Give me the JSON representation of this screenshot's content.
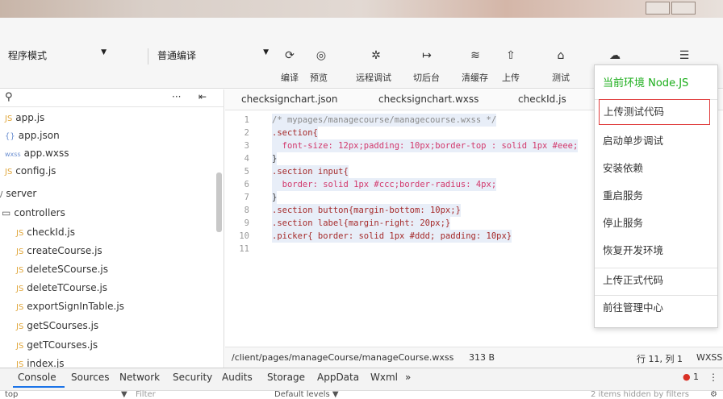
{
  "toolbar": {
    "mode_select": "程序模式",
    "compile_select": "普通编译",
    "buttons": {
      "compile": "编译",
      "preview": "预览",
      "remote_debug": "远程调试",
      "background": "切后台",
      "clear_cache": "清缓存",
      "upload": "上传",
      "test": "测试"
    }
  },
  "file_tree": {
    "items": [
      {
        "icon": "JS",
        "name": "app.js"
      },
      {
        "icon": "{}",
        "name": "app.json"
      },
      {
        "icon": "wxss",
        "name": "app.wxss"
      },
      {
        "icon": "JS",
        "name": "config.js"
      },
      {
        "icon": "",
        "name": "server"
      },
      {
        "icon": "",
        "name": "controllers"
      },
      {
        "icon": "JS",
        "name": "checkId.js"
      },
      {
        "icon": "JS",
        "name": "createCourse.js"
      },
      {
        "icon": "JS",
        "name": "deleteSCourse.js"
      },
      {
        "icon": "JS",
        "name": "deleteTCourse.js"
      },
      {
        "icon": "JS",
        "name": "exportSignInTable.js"
      },
      {
        "icon": "JS",
        "name": "getSCourses.js"
      },
      {
        "icon": "JS",
        "name": "getTCourses.js"
      },
      {
        "icon": "JS",
        "name": "index.js"
      }
    ]
  },
  "editor": {
    "tabs": [
      "checksignchart.json",
      "checksignchart.wxss",
      "checkId.js"
    ],
    "lines": [
      {
        "n": "1",
        "text": "/* mypages/managecourse/managecourse.wxss */"
      },
      {
        "n": "2",
        "text": ".section{"
      },
      {
        "n": "3",
        "text": "  font-size: 12px;padding: 10px;border-top : solid 1px #eee;"
      },
      {
        "n": "4",
        "text": "}"
      },
      {
        "n": "5",
        "text": ".section input{"
      },
      {
        "n": "6",
        "text": "  border: solid 1px #ccc;border-radius: 4px;"
      },
      {
        "n": "7",
        "text": "}"
      },
      {
        "n": "8",
        "text": ".section button{margin-bottom: 10px;}"
      },
      {
        "n": "9",
        "text": ".section label{margin-right: 20px;}"
      },
      {
        "n": "10",
        "text": ".picker{ border: solid 1px #ddd; padding: 10px}"
      },
      {
        "n": "11",
        "text": ""
      }
    ],
    "status": {
      "path": "/client/pages/manageCourse/manageCourse.wxss",
      "size": "313 B",
      "position": "行 11, 列 1",
      "lang": "WXSS"
    }
  },
  "menu": {
    "env_label": "当前环境 Node.JS",
    "items": [
      "上传测试代码",
      "启动单步调试",
      "安装依赖",
      "重启服务",
      "停止服务",
      "恢复开发环境",
      "上传正式代码",
      "前往管理中心"
    ]
  },
  "devtools": {
    "tabs": [
      "Console",
      "Sources",
      "Network",
      "Security",
      "Audits",
      "Storage",
      "AppData",
      "Wxml",
      "»"
    ],
    "error_count": "1",
    "filter_placeholder": "Filter",
    "levels": "Default levels ▼",
    "hidden_note": "2 items hidden by filters",
    "context": "top"
  },
  "colors": {
    "accent_green": "#1aad19",
    "highlight_red": "#e03c3c"
  }
}
